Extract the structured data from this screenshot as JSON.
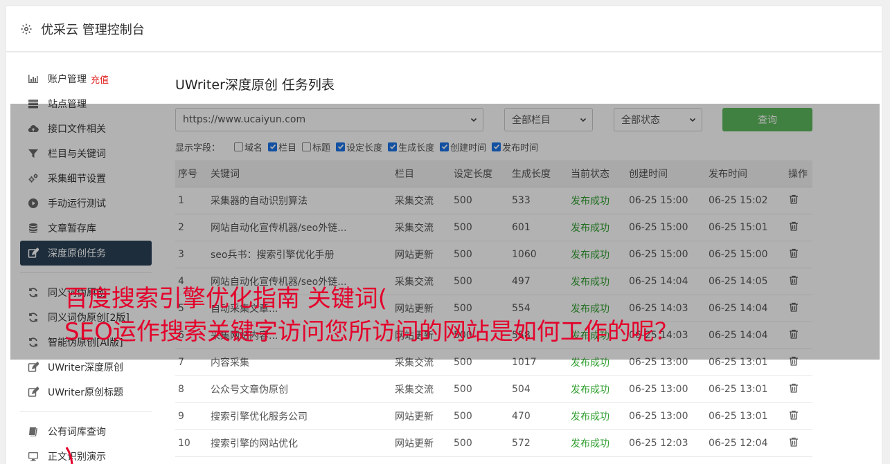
{
  "header": {
    "title": "优采云 管理控制台"
  },
  "sidebar": {
    "items": [
      {
        "label": "账户管理",
        "badge": "充值",
        "icon": "bar-chart-icon"
      },
      {
        "label": "站点管理",
        "icon": "server-icon"
      },
      {
        "label": "接口文件相关",
        "icon": "cloud-upload-icon"
      },
      {
        "label": "栏目与关键词",
        "icon": "filter-icon"
      },
      {
        "label": "采集细节设置",
        "icon": "cogs-icon"
      },
      {
        "label": "手动运行测试",
        "icon": "play-circle-icon"
      },
      {
        "label": "文章暂存库",
        "icon": "database-icon"
      },
      {
        "label": "深度原创任务",
        "icon": "edit-icon"
      },
      {
        "label": "同义词伪原创",
        "icon": "refresh-icon"
      },
      {
        "label": "同义词伪原创[2版]",
        "icon": "refresh-icon"
      },
      {
        "label": "智能伪原创[AI版]",
        "icon": "refresh-icon"
      },
      {
        "label": "UWriter深度原创",
        "icon": "edit-icon"
      },
      {
        "label": "UWriter原创标题",
        "icon": "edit-icon"
      },
      {
        "label": "公有词库查询",
        "icon": "book-icon"
      },
      {
        "label": "正文识别演示",
        "icon": "monitor-icon"
      }
    ]
  },
  "main": {
    "title": "UWriter深度原创 任务列表",
    "filters": {
      "site": "https://www.ucaiyun.com",
      "column": "全部栏目",
      "status": "全部状态",
      "query_label": "查询"
    },
    "fields": {
      "label": "显示字段：",
      "options": [
        {
          "label": "域名",
          "checked": false
        },
        {
          "label": "栏目",
          "checked": true
        },
        {
          "label": "标题",
          "checked": false
        },
        {
          "label": "设定长度",
          "checked": true
        },
        {
          "label": "生成长度",
          "checked": true
        },
        {
          "label": "创建时间",
          "checked": true
        },
        {
          "label": "发布时间",
          "checked": true
        }
      ]
    },
    "table": {
      "columns": [
        "序号",
        "关键词",
        "栏目",
        "设定长度",
        "生成长度",
        "当前状态",
        "创建时间",
        "发布时间",
        "操作"
      ],
      "rows": [
        [
          "1",
          "采集器的自动识别算法",
          "采集交流",
          "500",
          "533",
          "发布成功",
          "06-25 15:00",
          "06-25 15:02"
        ],
        [
          "2",
          "网站自动化宣传机器/seo外链...",
          "采集交流",
          "500",
          "601",
          "发布成功",
          "06-25 15:00",
          "06-25 15:01"
        ],
        [
          "3",
          "seo兵书：搜索引擎优化手册",
          "网站更新",
          "500",
          "1060",
          "发布成功",
          "06-25 15:00",
          "06-25 15:00"
        ],
        [
          "4",
          "网站自动化宣传机器/seo外链...",
          "采集交流",
          "500",
          "497",
          "发布成功",
          "06-25 14:04",
          "06-25 14:05"
        ],
        [
          "5",
          "自动采集文章...",
          "网站更新",
          "500",
          "554",
          "发布成功",
          "06-25 14:03",
          "06-25 14:04"
        ],
        [
          "6",
          "采集网站内容...",
          "网站更新",
          "500",
          "558",
          "发布成功",
          "06-25 14:03",
          "06-25 14:04"
        ],
        [
          "7",
          "内容采集",
          "采集交流",
          "500",
          "1017",
          "发布成功",
          "06-25 13:00",
          "06-25 13:01"
        ],
        [
          "8",
          "公众号文章伪原创",
          "采集交流",
          "500",
          "504",
          "发布成功",
          "06-25 13:00",
          "06-25 13:01"
        ],
        [
          "9",
          "搜索引擎优化服务公司",
          "网站更新",
          "500",
          "470",
          "发布成功",
          "06-25 13:00",
          "06-25 13:01"
        ],
        [
          "10",
          "搜索引擎的网站优化",
          "网站更新",
          "500",
          "572",
          "发布成功",
          "06-25 12:03",
          "06-25 12:04"
        ]
      ]
    }
  },
  "overlay": {
    "line1": "百度搜索引擎优化指南 关键词(",
    "line2": "SEO运作搜索关键字访问您所访问的网站是如何工作的呢？"
  },
  "colors": {
    "active_nav": "#2a4157",
    "query_button": "#5cb85c",
    "success": "#2e9e2e",
    "headline": "#e4002b",
    "recharge": "#e02020"
  }
}
